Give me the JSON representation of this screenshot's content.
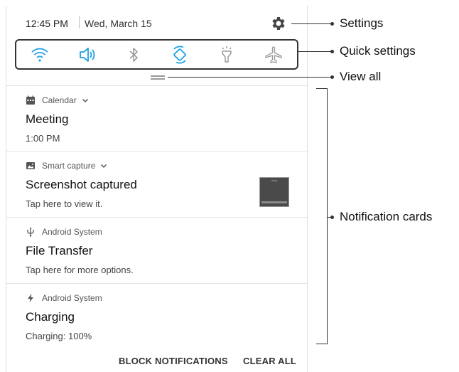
{
  "status": {
    "time": "12:45 PM",
    "date": "Wed, March 15"
  },
  "quick_settings": [
    {
      "name": "wifi-icon",
      "active": true
    },
    {
      "name": "sound-icon",
      "active": true
    },
    {
      "name": "bluetooth-icon",
      "active": false
    },
    {
      "name": "auto-rotate-icon",
      "active": true
    },
    {
      "name": "flashlight-icon",
      "active": false
    },
    {
      "name": "airplane-mode-icon",
      "active": false
    }
  ],
  "colors": {
    "accent": "#1ea1e6",
    "inactive": "#9a9a9a"
  },
  "notifications": [
    {
      "app": "Calendar",
      "has_chevron": true,
      "title": "Meeting",
      "text": "1:00 PM",
      "icon": "calendar-icon"
    },
    {
      "app": "Smart capture",
      "has_chevron": true,
      "title": "Screenshot captured",
      "text": "Tap here to view it.",
      "icon": "image-icon"
    },
    {
      "app": "Android System",
      "has_chevron": false,
      "title": "File Transfer",
      "text": "Tap here for more options.",
      "icon": "usb-icon"
    },
    {
      "app": "Android System",
      "has_chevron": false,
      "title": "Charging",
      "text": "Charging: 100%",
      "icon": "charging-icon"
    }
  ],
  "actions": {
    "block": "BLOCK NOTIFICATIONS",
    "clear": "CLEAR ALL"
  },
  "callouts": {
    "settings": "Settings",
    "quick_settings": "Quick settings",
    "view_all": "View all",
    "notification_cards": "Notification cards"
  }
}
